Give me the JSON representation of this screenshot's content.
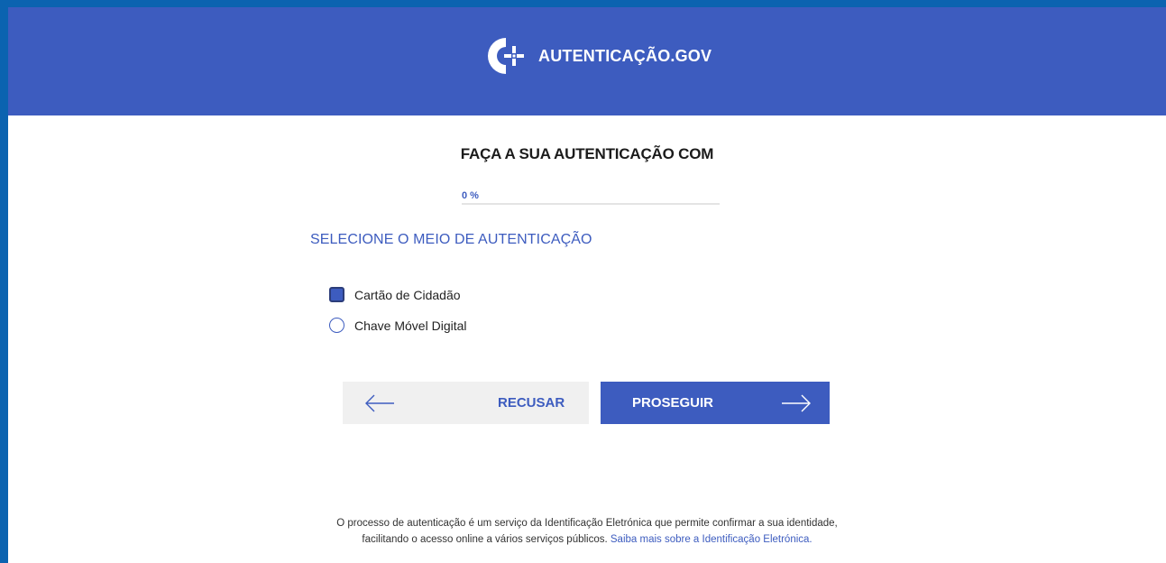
{
  "header": {
    "brand_text": "AUTENTICAÇÃO.GOV",
    "brand_color": "#3d5cbf"
  },
  "main": {
    "title": "FAÇA A SUA AUTENTICAÇÃO COM",
    "progress_label": "0 %",
    "progress_value": 0,
    "section_title": "SELECIONE O MEIO DE AUTENTICAÇÃO",
    "options": [
      {
        "label": "Cartão de Cidadão",
        "selected": true
      },
      {
        "label": "Chave Móvel Digital",
        "selected": false
      }
    ]
  },
  "actions": {
    "refuse_label": "RECUSAR",
    "next_label": "PROSEGUIR"
  },
  "footer": {
    "line1": "O processo de autenticação é um serviço da Identificação Eletrónica que permite confirmar a sua identidade,",
    "line2": "facilitando o acesso online a vários serviços públicos.",
    "link": "Saiba mais sobre a Identificação Eletrónica."
  }
}
